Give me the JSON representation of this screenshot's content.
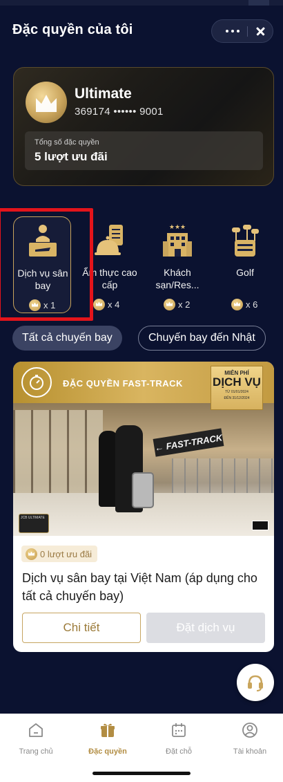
{
  "header": {
    "title": "Đặc quyền của tôi"
  },
  "member_card": {
    "tier": "Ultimate",
    "card_number": "369174 •••••• 9001",
    "total_label": "Tổng số đặc quyền",
    "total_value": "5 lượt ưu đãi"
  },
  "categories": [
    {
      "label": "Dịch vụ sân bay",
      "count": "x 1",
      "icon": "airport-service-icon"
    },
    {
      "label": "Ẩm thực cao cấp",
      "count": "x 4",
      "icon": "fine-dining-icon"
    },
    {
      "label": "Khách sạn/Res...",
      "count": "x 2",
      "icon": "hotel-icon"
    },
    {
      "label": "Golf",
      "count": "x 6",
      "icon": "golf-icon"
    }
  ],
  "filters": {
    "active": "Tất cả chuyến bay",
    "inactive": "Chuyến bay đến Nhật"
  },
  "offer": {
    "banner": {
      "title": "ĐẶC QUYỀN FAST-TRACK",
      "badge_line1": "MIỄN PHÍ",
      "badge_line2": "DỊCH VỤ",
      "badge_line3": "TỪ 01/01/2024",
      "badge_line4": "ĐẾN 31/12/2024",
      "sign_text": "← FAST-TRACK",
      "card_thumb_text": "JCB ULTIMATE"
    },
    "remaining": "0 lượt ưu đãi",
    "title": "Dịch vụ sân bay tại Việt Nam (áp dụng cho tất cả chuyến bay)",
    "detail_button": "Chi tiết",
    "book_button": "Đặt dịch vụ"
  },
  "bottom_nav": [
    {
      "label": "Trang chủ",
      "icon": "home-icon",
      "active": false
    },
    {
      "label": "Đặc quyền",
      "icon": "gift-icon",
      "active": true
    },
    {
      "label": "Đặt chỗ",
      "icon": "calendar-icon",
      "active": false
    },
    {
      "label": "Tài khoản",
      "icon": "account-icon",
      "active": false
    }
  ],
  "colors": {
    "background": "#0b1230",
    "gold": "#c9a55c",
    "highlight": "#e3141b",
    "card_white": "#ffffff"
  }
}
